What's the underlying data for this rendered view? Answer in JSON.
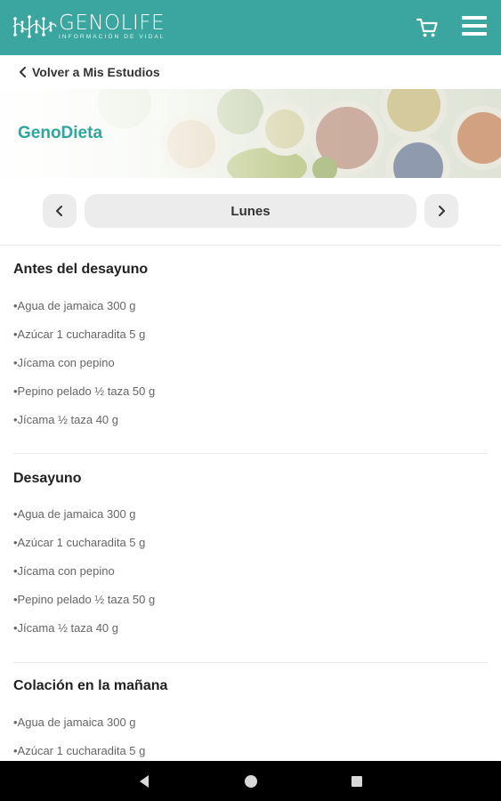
{
  "brand": {
    "name": "GENOLIFE",
    "tagline": "INFORMACIÓN DE VIDAL"
  },
  "colors": {
    "topbar": "#3aa69f",
    "accent": "#2ea69e",
    "android_bar": "#000000"
  },
  "header": {
    "cart_icon": "cart-icon",
    "menu_icon": "hamburger-menu-icon"
  },
  "back_link": {
    "label": "Volver a Mis Estudios"
  },
  "hero": {
    "title": "GenoDieta"
  },
  "day_selector": {
    "current_day": "Lunes",
    "prev_icon": "chevron-left-icon",
    "next_icon": "chevron-right-icon"
  },
  "sections": [
    {
      "title": "Antes del desayuno",
      "items": [
        "•Agua de jamaica 300 g",
        "•Azúcar 1 cucharadita 5 g",
        "•Jícama con pepino",
        "•Pepino pelado ½ taza 50 g",
        "•Jícama ½ taza 40 g"
      ]
    },
    {
      "title": "Desayuno",
      "items": [
        "•Agua de jamaica 300 g",
        "•Azúcar 1 cucharadita 5 g",
        "•Jícama con pepino",
        "•Pepino pelado ½ taza 50 g",
        "•Jícama ½ taza 40 g"
      ]
    },
    {
      "title": "Colación en la mañana",
      "items": [
        "•Agua de jamaica 300 g",
        "•Azúcar 1 cucharadita 5 g"
      ]
    }
  ],
  "system_nav": {
    "back_icon": "system-back-icon",
    "home_icon": "system-home-icon",
    "recents_icon": "system-recents-icon"
  }
}
